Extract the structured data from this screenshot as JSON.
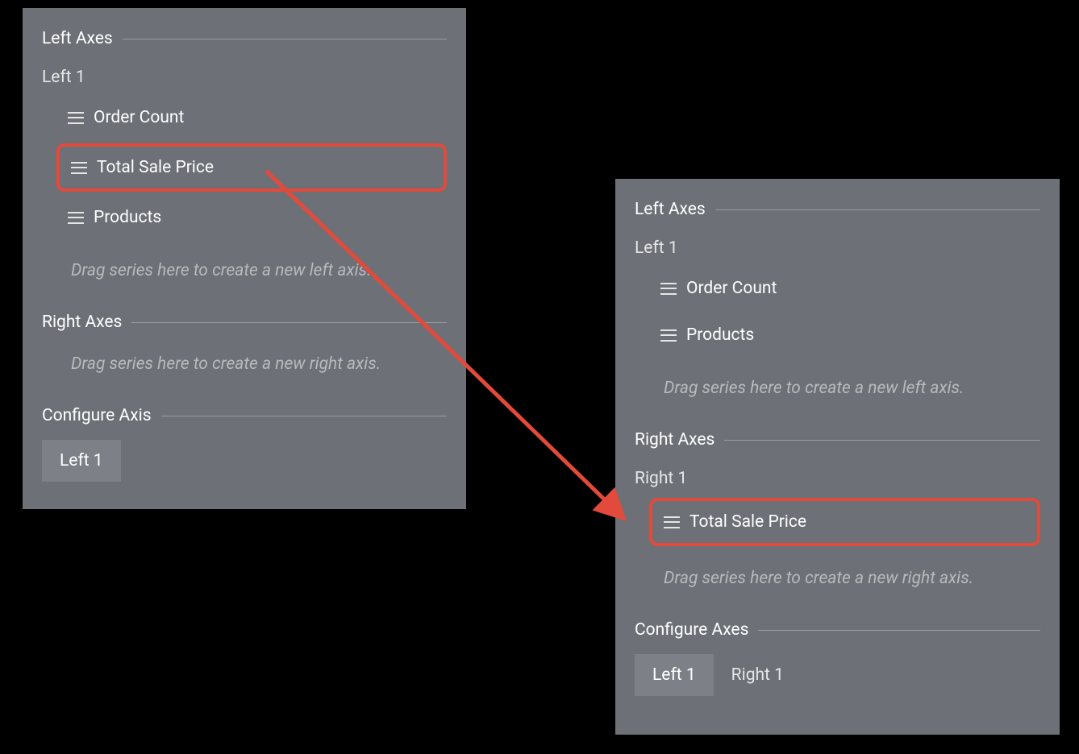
{
  "colors": {
    "highlight": "#e24a3b",
    "panel_bg": "#6d7076"
  },
  "left_panel": {
    "left_axes": {
      "header": "Left Axes",
      "axis_name": "Left 1",
      "items": [
        {
          "label": "Order Count",
          "highlighted": false
        },
        {
          "label": "Total Sale Price",
          "highlighted": true
        },
        {
          "label": "Products",
          "highlighted": false
        }
      ],
      "drop_hint": "Drag series here to create a new left axis."
    },
    "right_axes": {
      "header": "Right Axes",
      "drop_hint": "Drag series here to create a new right axis."
    },
    "configure": {
      "header": "Configure Axis",
      "tabs": [
        {
          "label": "Left 1",
          "active": true
        }
      ]
    }
  },
  "right_panel": {
    "left_axes": {
      "header": "Left Axes",
      "axis_name": "Left 1",
      "items": [
        {
          "label": "Order Count",
          "highlighted": false
        },
        {
          "label": "Products",
          "highlighted": false
        }
      ],
      "drop_hint": "Drag series here to create a new left axis."
    },
    "right_axes": {
      "header": "Right Axes",
      "axis_name": "Right 1",
      "items": [
        {
          "label": "Total Sale Price",
          "highlighted": true
        }
      ],
      "drop_hint": "Drag series here to create a new right axis."
    },
    "configure": {
      "header": "Configure Axes",
      "tabs": [
        {
          "label": "Left 1",
          "active": true
        },
        {
          "label": "Right 1",
          "active": false
        }
      ]
    }
  }
}
